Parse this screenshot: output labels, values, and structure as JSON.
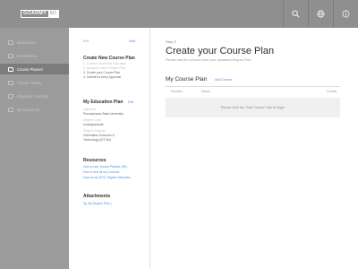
{
  "topbar": {
    "logo_main": "GOARMY",
    "logo_ed": "ED",
    "icons": [
      "search-icon",
      "globe-icon",
      "info-icon"
    ]
  },
  "nav": {
    "items": [
      {
        "label": "Dashboard",
        "active": false
      },
      {
        "label": "Enrollments",
        "active": false
      },
      {
        "label": "Course Planner",
        "active": true
      },
      {
        "label": "Course History",
        "active": false
      },
      {
        "label": "Education Records",
        "active": false
      },
      {
        "label": "Messages (3)",
        "active": false
      }
    ]
  },
  "panel": {
    "prev_label": "Exit",
    "next_label": "Next",
    "create_heading": "Create New Course Plan",
    "create_steps": [
      "1. Confirm Goals and Education",
      "2. Upload/Confirm Degree Plan",
      "3. Create your Course Plan",
      "4. Submit for Army Approval"
    ],
    "education_heading": "My Education Plan",
    "education_edit": "Edit",
    "education_lines": [
      "Institution",
      "Pennsylvania State University",
      "Degree Level",
      "Undergraduate",
      "Degree Program",
      "Information Sciences &",
      "Technology (IST BA)"
    ],
    "resources_heading": "Resources",
    "resources_links": [
      "How to use Course Planner (3B)",
      "How to see all my Courses",
      "How to use SOC Degree Networks"
    ],
    "attachments_heading": "Attachments",
    "attachment_link": "My Degree Plan ⤓"
  },
  "main": {
    "step": "Step 3",
    "title": "Create your Course Plan",
    "subtitle": "Please add the courses from your uploaded Degree Plan",
    "section_title": "My Course Plan",
    "add_course_link": "Add Course",
    "columns": [
      "Number",
      "Name",
      "Credits"
    ],
    "empty_message": "Please click the \"Add Course\" link to begin"
  },
  "colors": {
    "topbar": "#8f8f8f",
    "nav_bg": "#9b9b9b",
    "nav_active": "#7c7c7c",
    "link": "#4a8fe7"
  }
}
